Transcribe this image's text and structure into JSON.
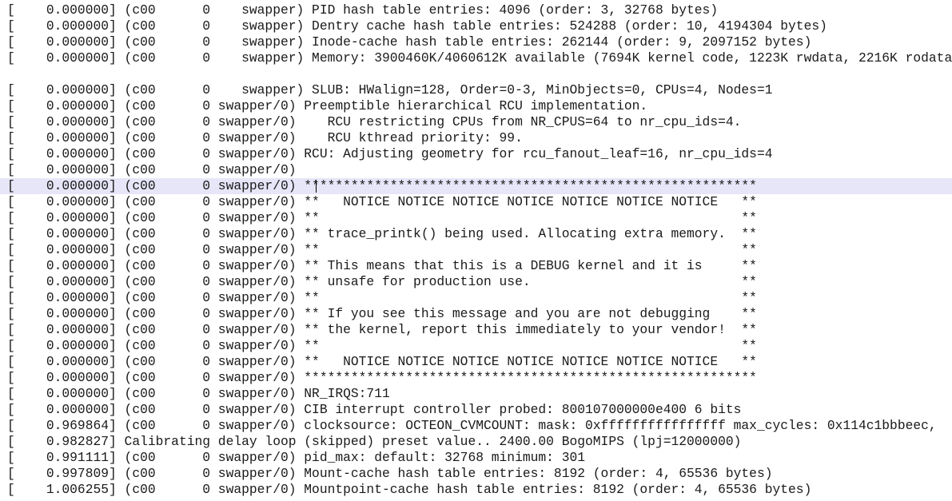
{
  "log": {
    "lines": [
      "[    0.000000] (c00      0    swapper) PID hash table entries: 4096 (order: 3, 32768 bytes)",
      "[    0.000000] (c00      0    swapper) Dentry cache hash table entries: 524288 (order: 10, 4194304 bytes)",
      "[    0.000000] (c00      0    swapper) Inode-cache hash table entries: 262144 (order: 9, 2097152 bytes)",
      "[    0.000000] (c00      0    swapper) Memory: 3900460K/4060612K available (7694K kernel code, 1223K rwdata, 2216K rodata",
      "",
      "[    0.000000] (c00      0    swapper) SLUB: HWalign=128, Order=0-3, MinObjects=0, CPUs=4, Nodes=1",
      "[    0.000000] (c00      0 swapper/0) Preemptible hierarchical RCU implementation.",
      "[    0.000000] (c00      0 swapper/0)    RCU restricting CPUs from NR_CPUS=64 to nr_cpu_ids=4.",
      "[    0.000000] (c00      0 swapper/0)    RCU kthread priority: 99.",
      "[    0.000000] (c00      0 swapper/0) RCU: Adjusting geometry for rcu_fanout_leaf=16, nr_cpu_ids=4",
      "[    0.000000] (c00      0 swapper/0)",
      "[    0.000000] (c00      0 swapper/0) **********************************************************",
      "[    0.000000] (c00      0 swapper/0) **   NOTICE NOTICE NOTICE NOTICE NOTICE NOTICE NOTICE   **",
      "[    0.000000] (c00      0 swapper/0) **                                                      **",
      "[    0.000000] (c00      0 swapper/0) ** trace_printk() being used. Allocating extra memory.  **",
      "[    0.000000] (c00      0 swapper/0) **                                                      **",
      "[    0.000000] (c00      0 swapper/0) ** This means that this is a DEBUG kernel and it is     **",
      "[    0.000000] (c00      0 swapper/0) ** unsafe for production use.                           **",
      "[    0.000000] (c00      0 swapper/0) **                                                      **",
      "[    0.000000] (c00      0 swapper/0) ** If you see this message and you are not debugging    **",
      "[    0.000000] (c00      0 swapper/0) ** the kernel, report this immediately to your vendor!  **",
      "[    0.000000] (c00      0 swapper/0) **                                                      **",
      "[    0.000000] (c00      0 swapper/0) **   NOTICE NOTICE NOTICE NOTICE NOTICE NOTICE NOTICE   **",
      "[    0.000000] (c00      0 swapper/0) **********************************************************",
      "[    0.000000] (c00      0 swapper/0) NR_IRQS:711",
      "[    0.000000] (c00      0 swapper/0) CIB interrupt controller probed: 800107000000e400 6 bits",
      "[    0.969864] (c00      0 swapper/0) clocksource: OCTEON_CVMCOUNT: mask: 0xffffffffffffffff max_cycles: 0x114c1bbbeec,",
      "[    0.982827] Calibrating delay loop (skipped) preset value.. 2400.00 BogoMIPS (lpj=12000000)",
      "[    0.991111] (c00      0 swapper/0) pid_max: default: 32768 minimum: 301",
      "[    0.997809] (c00      0 swapper/0) Mount-cache hash table entries: 8192 (order: 4, 65536 bytes)",
      "[    1.006255] (c00      0 swapper/0) Mountpoint-cache hash table entries: 8192 (order: 4, 65536 bytes)"
    ]
  },
  "colors": {
    "background": "#ffffff",
    "text": "#1a1a1a",
    "highlight_line": "#e6e6f8"
  }
}
